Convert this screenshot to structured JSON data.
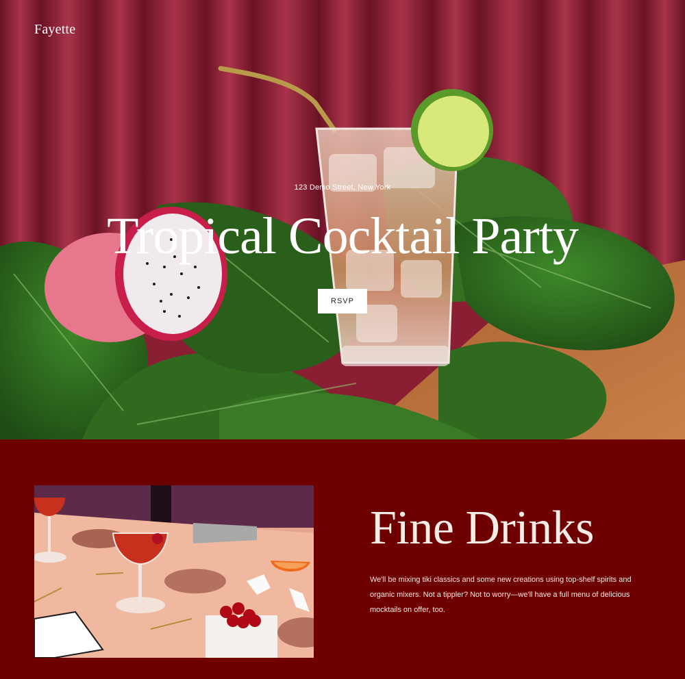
{
  "site": {
    "logo": "Fayette"
  },
  "hero": {
    "address": "123 Demo Street, New York",
    "title": "Tropical Cocktail Party",
    "rsvp_label": "RSVP"
  },
  "fine_drinks": {
    "title": "Fine Drinks",
    "body": "We'll be mixing tiki classics and some new creations using top-shelf spirits and organic mixers. Not a tippler? Not to worry—we'll have a full menu of delicious mocktails on offer, too."
  },
  "colors": {
    "section_bg": "#6e0000",
    "curtain": "#8a1f33",
    "leaf": "#2f6a1f",
    "table_wood": "#b8703c"
  }
}
